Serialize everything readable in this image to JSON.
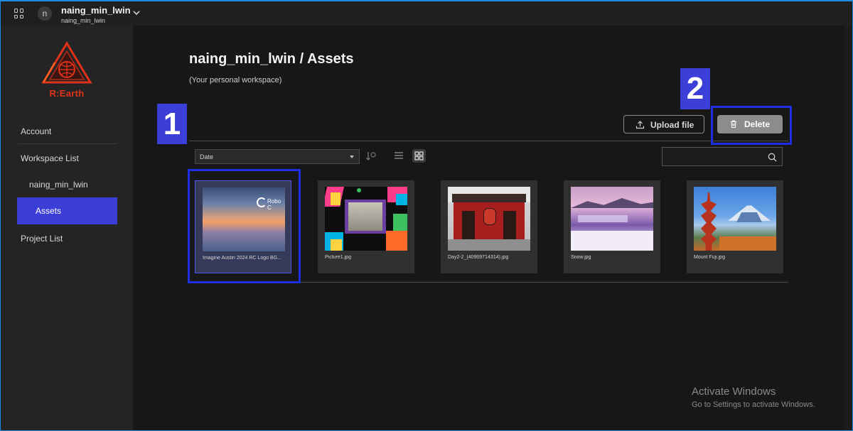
{
  "workspace": {
    "avatar_letter": "n",
    "name": "naing_min_lwin",
    "sub": "naing_min_lwin"
  },
  "sidebar": {
    "logo_text": "R:Earth",
    "items": [
      {
        "label": "Account"
      },
      {
        "label": "Workspace List"
      },
      {
        "label": "naing_min_lwin"
      },
      {
        "label": "Assets"
      },
      {
        "label": "Project List"
      }
    ]
  },
  "main": {
    "title": "naing_min_lwin / Assets",
    "subtitle": "(Your personal workspace)",
    "upload_label": "Upload file",
    "delete_label": "Delete",
    "sort_value": "Date",
    "search_placeholder": "",
    "assets": [
      {
        "name": "Imagine Austin 2024 RC Logo BG...",
        "overlay_text": "Robo C",
        "selected": true
      },
      {
        "name": "Picture1.jpg",
        "selected": false
      },
      {
        "name": "Day2-2_(40909714314).jpg",
        "selected": false
      },
      {
        "name": "Snow.jpg",
        "selected": false
      },
      {
        "name": "Mount Fuji.jpg",
        "selected": false
      }
    ]
  },
  "annotations": {
    "badge1": "1",
    "badge2": "2",
    "highlight_color": "#1d2fe0",
    "badge_color": "#3b3fd8"
  },
  "watermark": {
    "line1": "Activate Windows",
    "line2": "Go to Settings to activate Windows."
  },
  "colors": {
    "accent": "#3b3fd8",
    "brand": "#e3321a",
    "background": "#171717",
    "sidebar": "#242424"
  }
}
